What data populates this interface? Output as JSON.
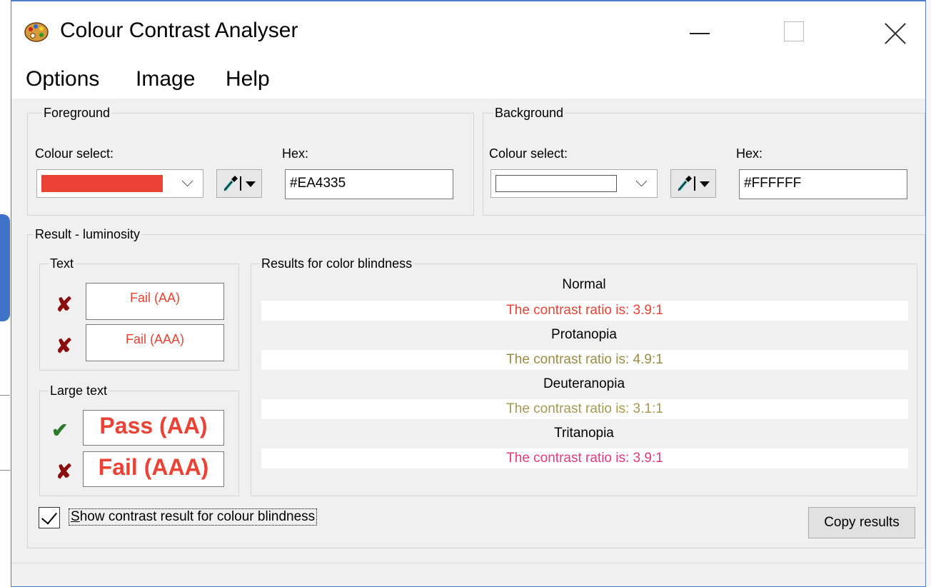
{
  "window": {
    "title": "Colour Contrast Analyser"
  },
  "menu": {
    "items": [
      "Options",
      "Image",
      "Help"
    ]
  },
  "foreground": {
    "legend": "Foreground",
    "colour_select_label": "Colour select:",
    "hex_label": "Hex:",
    "hex_value": "#EA4335",
    "swatch_color": "#ea4335"
  },
  "background": {
    "legend": "Background",
    "colour_select_label": "Colour select:",
    "hex_label": "Hex:",
    "hex_value": "#FFFFFF",
    "swatch_color": "#ffffff"
  },
  "result": {
    "legend": "Result - luminosity",
    "text": {
      "legend": "Text",
      "aa": {
        "label": "Fail (AA)",
        "status": "fail"
      },
      "aaa": {
        "label": "Fail (AAA)",
        "status": "fail"
      }
    },
    "large_text": {
      "legend": "Large text",
      "aa": {
        "label": "Pass (AA)",
        "status": "pass"
      },
      "aaa": {
        "label": "Fail (AAA)",
        "status": "fail"
      }
    },
    "color_blindness": {
      "legend": "Results for color blindness",
      "rows": [
        {
          "name": "Normal",
          "result": "The contrast ratio is: 3.9:1",
          "color": "#ea4335"
        },
        {
          "name": "Protanopia",
          "result": "The contrast ratio is: 4.9:1",
          "color": "#9b8c46"
        },
        {
          "name": "Deuteranopia",
          "result": "The contrast ratio is: 3.1:1",
          "color": "#a59a52"
        },
        {
          "name": "Tritanopia",
          "result": "The contrast ratio is: 3.9:1",
          "color": "#e83a7c"
        }
      ]
    }
  },
  "footer": {
    "checkbox_u": "S",
    "checkbox_rest": "how contrast result for colour blindness",
    "checkbox_checked": true,
    "copy_button": "Copy results"
  },
  "icons": {
    "app": "palette-icon",
    "picker": "eyedropper-icon",
    "fail": "cross-mark-icon",
    "pass": "check-mark-icon"
  }
}
